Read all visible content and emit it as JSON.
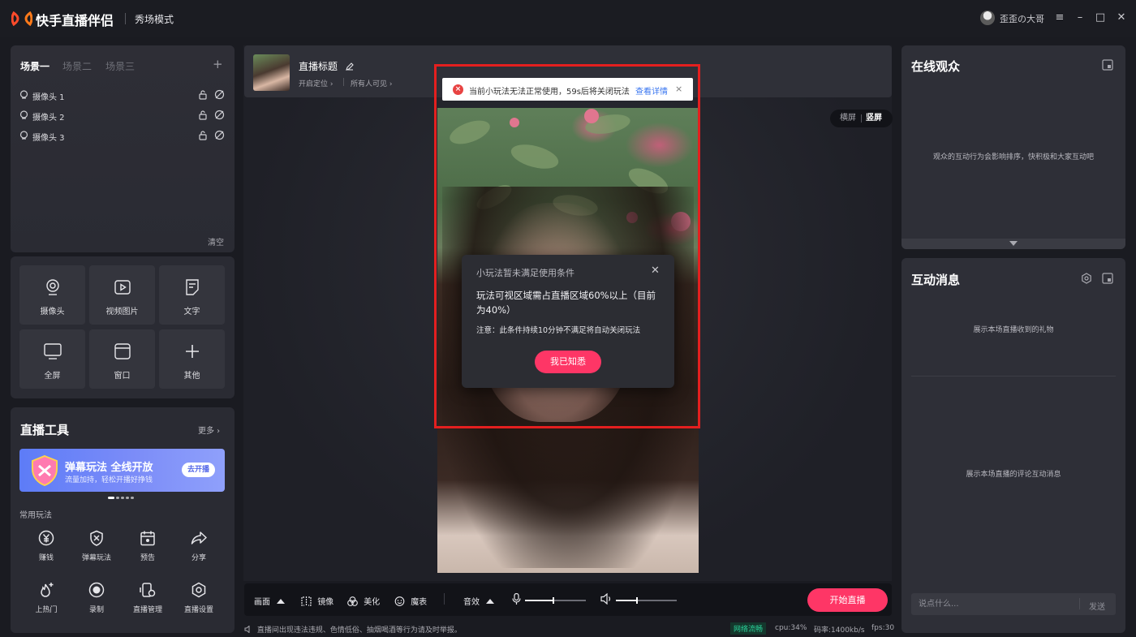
{
  "app": {
    "title": "快手直播伴侣",
    "mode": "秀场模式",
    "user": "歪歪の大哥"
  },
  "window_controls": [
    "≡",
    "–",
    "□",
    "✕"
  ],
  "scenes": {
    "tabs": [
      "场景一",
      "场景二",
      "场景三"
    ],
    "add": "+",
    "cameras": [
      "摄像头 1",
      "摄像头 2",
      "摄像头 3"
    ],
    "clear": "清空"
  },
  "sources": [
    {
      "label": "摄像头",
      "icon": "webcam-icon"
    },
    {
      "label": "视频图片",
      "icon": "video-play-icon"
    },
    {
      "label": "文字",
      "icon": "text-doc-icon"
    },
    {
      "label": "全屏",
      "icon": "monitor-icon"
    },
    {
      "label": "窗口",
      "icon": "window-icon"
    },
    {
      "label": "其他",
      "icon": "plus-icon"
    }
  ],
  "tools": {
    "title": "直播工具",
    "more": "更多 ›",
    "banner": {
      "title": "弹幕玩法 全线开放",
      "subtitle": "流量加持，轻松开播好挣钱",
      "button": "去开播"
    },
    "common_label": "常用玩法",
    "items": [
      {
        "label": "赚钱",
        "icon": "yen-coin-icon"
      },
      {
        "label": "弹幕玩法",
        "icon": "shield-x-icon"
      },
      {
        "label": "预告",
        "icon": "calendar-icon"
      },
      {
        "label": "分享",
        "icon": "share-arrow-icon"
      },
      {
        "label": "上热门",
        "icon": "flame-plus-icon"
      },
      {
        "label": "录制",
        "icon": "record-icon"
      },
      {
        "label": "直播管理",
        "icon": "device-settings-icon"
      },
      {
        "label": "直播设置",
        "icon": "hexagon-gear-icon"
      }
    ]
  },
  "stream": {
    "title": "直播标题",
    "location": "开启定位 ›",
    "visibility": "所有人可见 ›",
    "orientation": {
      "horizontal": "横屏",
      "vertical": "竖屏"
    }
  },
  "toast": {
    "text": "当前小玩法无法正常使用，59s后将关闭玩法",
    "link": "查看详情",
    "close": "×"
  },
  "dialog": {
    "title": "小玩法暂未满足使用条件",
    "body": "玩法可视区域需占直播区域60%以上（目前为40%）",
    "note": "注意：此条件持续10分钟不满足将自动关闭玩法",
    "button": "我已知悉",
    "close": "✕"
  },
  "bottom_bar": {
    "screen": "画面",
    "mirror": "镜像",
    "beauty": "美化",
    "magic": "魔表",
    "sound_effect": "音效",
    "mic_level": 0.45,
    "speaker_level": 0.33,
    "start": "开始直播"
  },
  "status": {
    "notice": "直播间出现违法违规、色情低俗、抽烟喝酒等行为请及时举报。",
    "network": "网络流畅",
    "cpu": "cpu:34%",
    "bitrate": "码率:1400kb/s",
    "fps": "fps:30"
  },
  "audience": {
    "title": "在线观众",
    "hint": "观众的互动行为会影响排序，快积极和大家互动吧"
  },
  "messages": {
    "title": "互动消息",
    "gift_hint": "展示本场直播收到的礼物",
    "comment_hint": "展示本场直播的评论互动消息",
    "input_placeholder": "说点什么...",
    "send": "发送"
  },
  "colors": {
    "accent": "#fe3666",
    "link": "#3b77f0",
    "error": "#e84342",
    "highlight_box": "#e41f1f",
    "network_ok": "#2bd29a"
  }
}
